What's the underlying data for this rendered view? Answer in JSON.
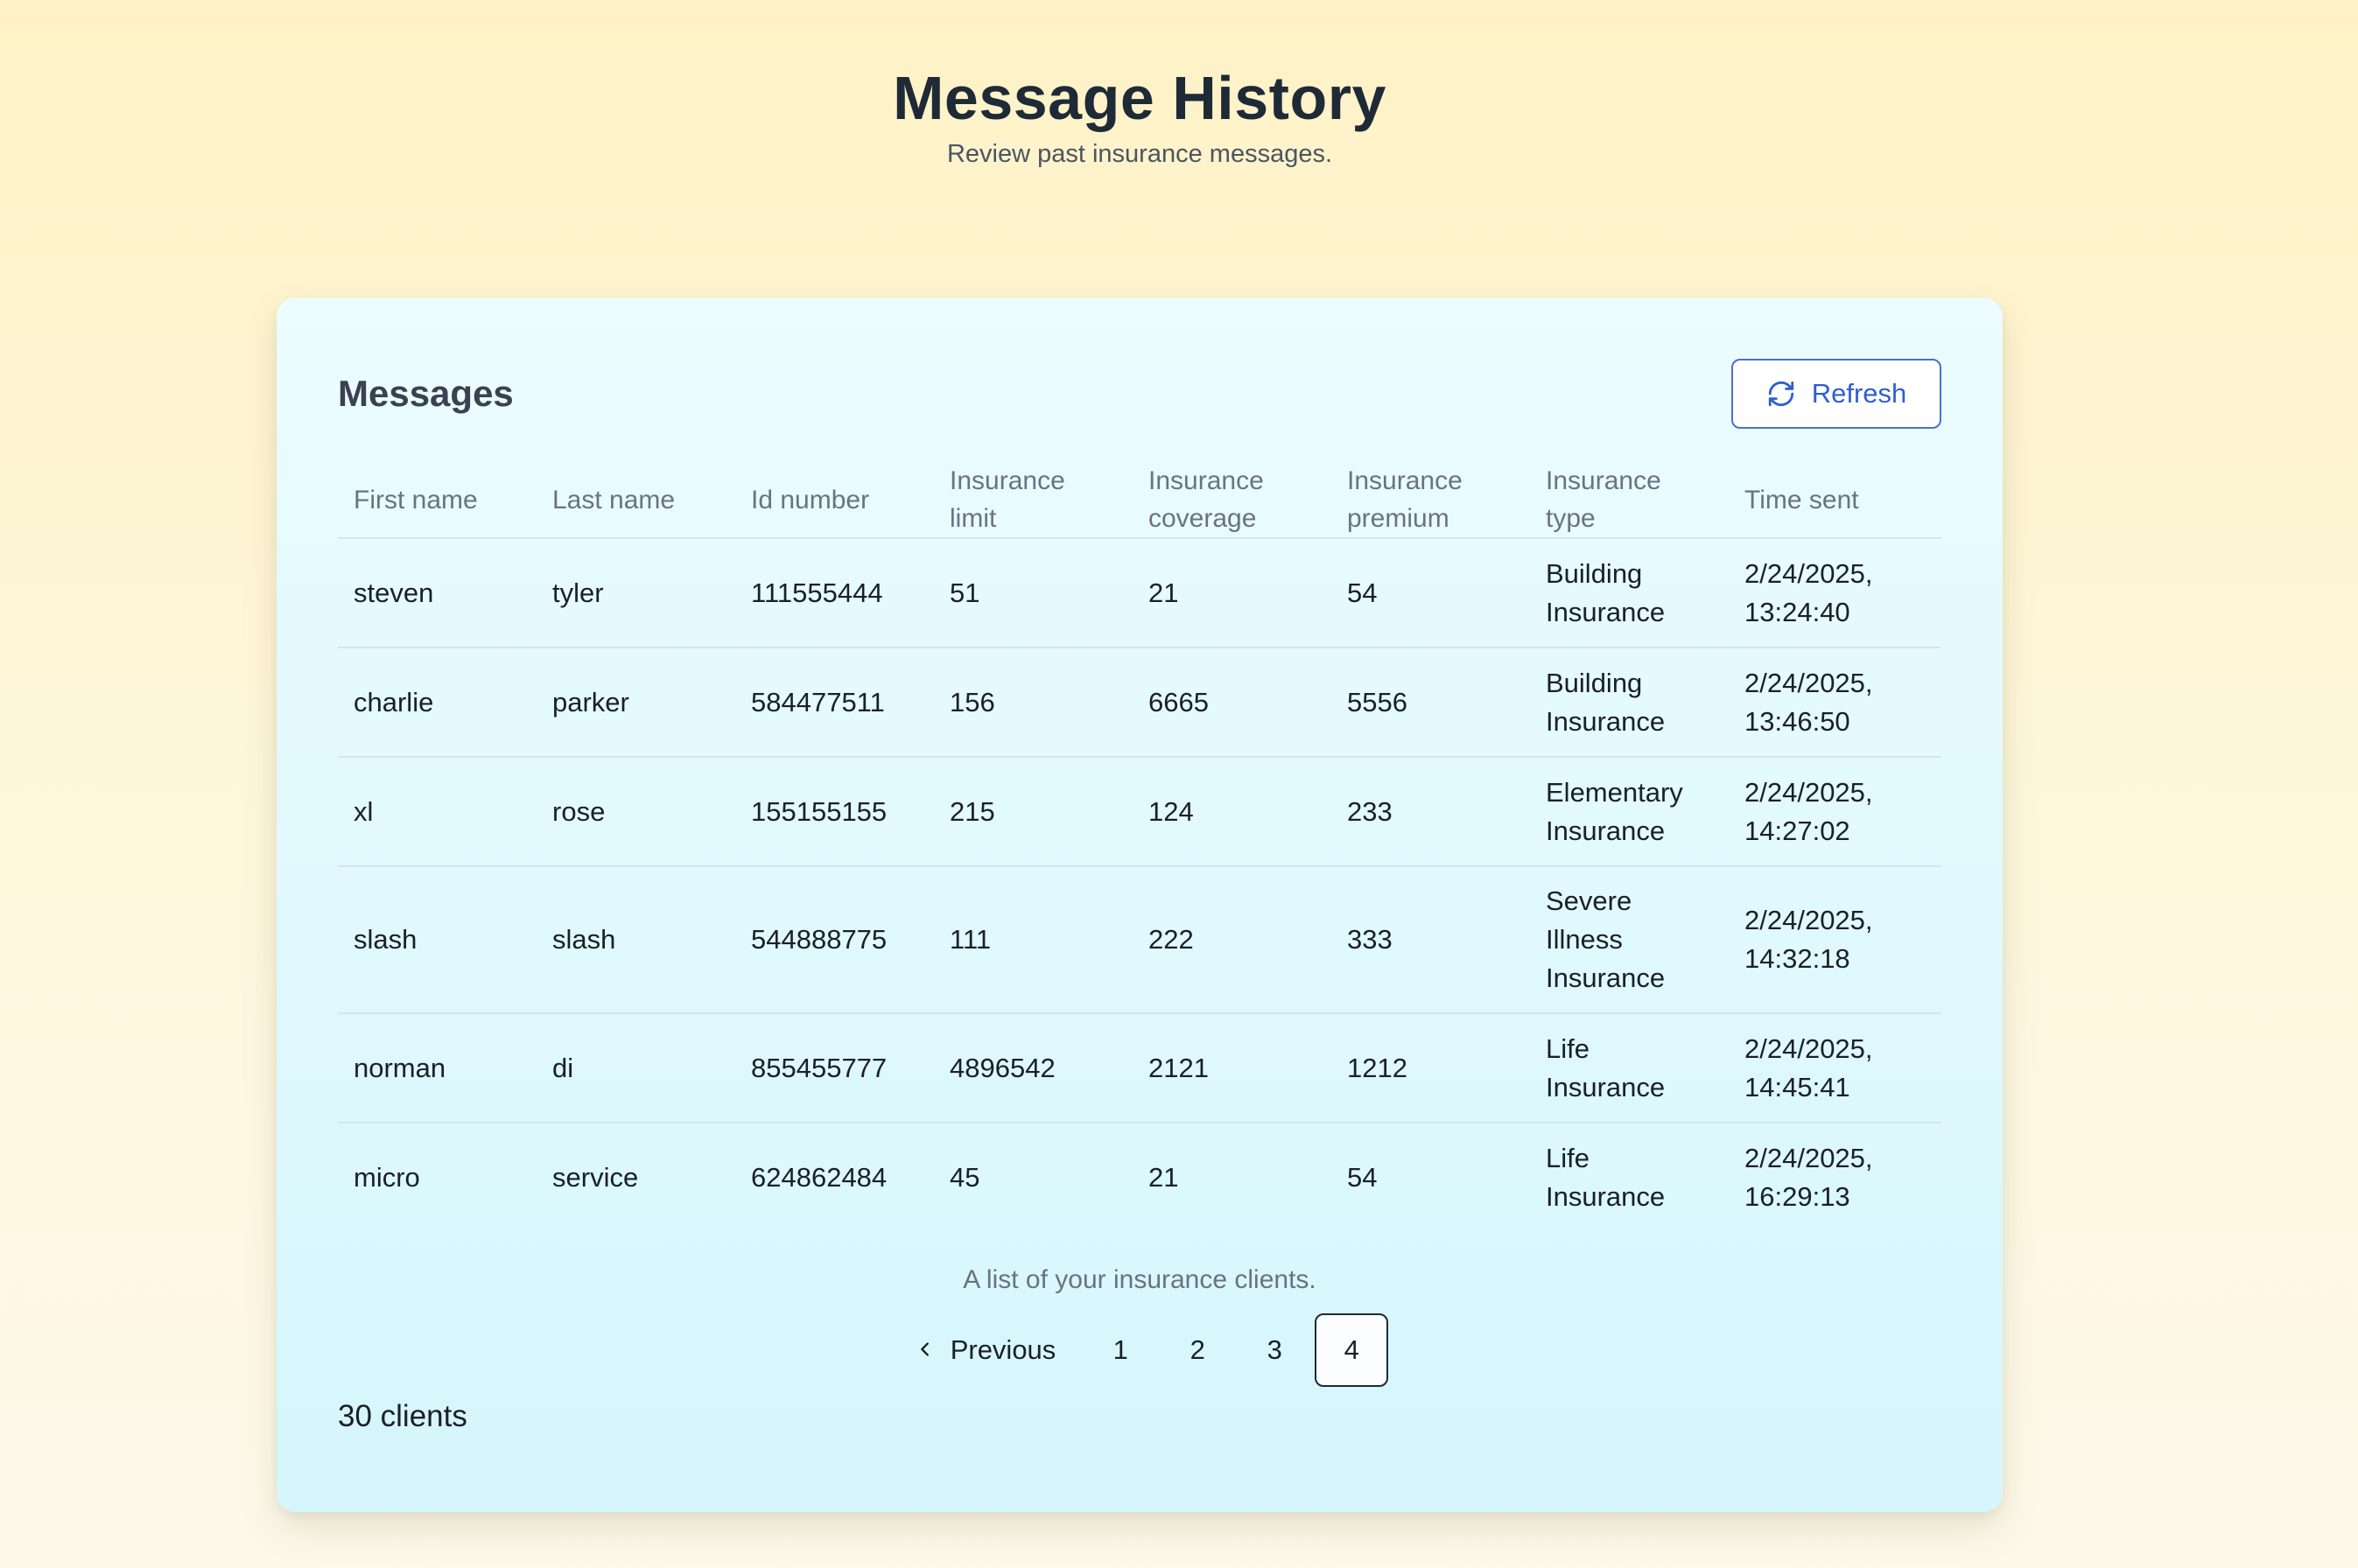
{
  "header": {
    "title": "Message History",
    "subtitle": "Review past insurance messages."
  },
  "card": {
    "title": "Messages",
    "refresh_label": "Refresh",
    "refresh_icon": "refresh-icon"
  },
  "table": {
    "columns": [
      "First name",
      "Last name",
      "Id number",
      "Insurance limit",
      "Insurance coverage",
      "Insurance premium",
      "Insurance type",
      "Time sent"
    ],
    "rows": [
      [
        "steven",
        "tyler",
        "111555444",
        "51",
        "21",
        "54",
        "Building Insurance",
        "2/24/2025, 13:24:40"
      ],
      [
        "charlie",
        "parker",
        "584477511",
        "156",
        "6665",
        "5556",
        "Building Insurance",
        "2/24/2025, 13:46:50"
      ],
      [
        "xl",
        "rose",
        "155155155",
        "215",
        "124",
        "233",
        "Elementary Insurance",
        "2/24/2025, 14:27:02"
      ],
      [
        "slash",
        "slash",
        "544888775",
        "111",
        "222",
        "333",
        "Severe Illness Insurance",
        "2/24/2025, 14:32:18"
      ],
      [
        "norman",
        "di",
        "855455777",
        "4896542",
        "2121",
        "1212",
        "Life Insurance",
        "2/24/2025, 14:45:41"
      ],
      [
        "micro",
        "service",
        "624862484",
        "45",
        "21",
        "54",
        "Life Insurance",
        "2/24/2025, 16:29:13"
      ]
    ],
    "caption": "A list of your insurance clients."
  },
  "pagination": {
    "previous_label": "Previous",
    "pages": [
      "1",
      "2",
      "3",
      "4"
    ],
    "current": "4"
  },
  "footer": {
    "count": "30 clients"
  },
  "colors": {
    "accent": "#2f5fd0",
    "background": "#fef2c6",
    "card": "#e4f9fd"
  }
}
